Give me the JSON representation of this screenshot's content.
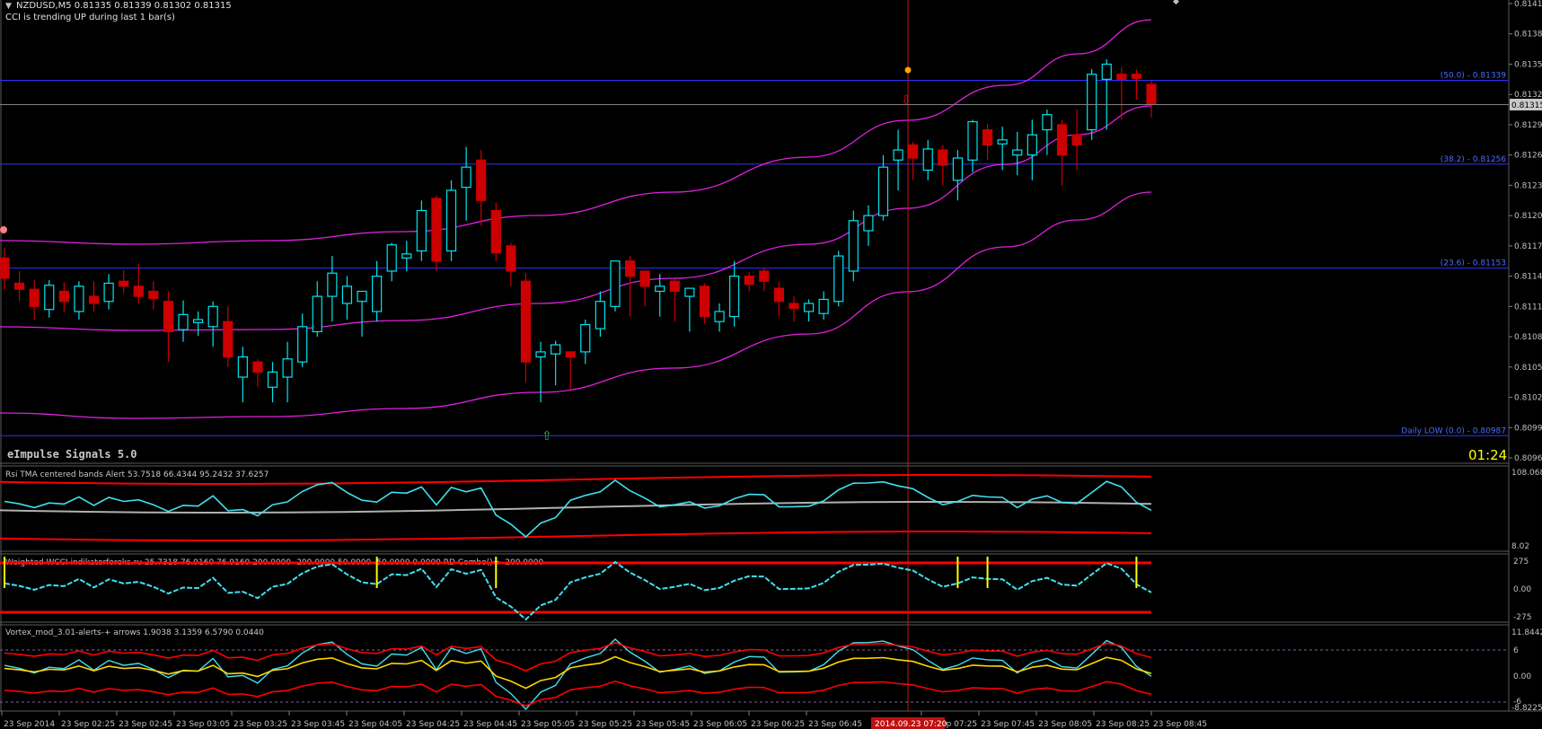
{
  "header": {
    "symbol_line": "NZDUSD,M5  0.81335 0.81339 0.81302 0.81315",
    "cci_note": "CCI is trending UP during last 1 bar(s)"
  },
  "main": {
    "indicator_name": "eImpulse Signals 5.0",
    "timer": "01:24",
    "price_ticks": [
      "0.81415",
      "0.81385",
      "0.81355",
      "0.81325",
      "0.81295",
      "0.81265",
      "0.81235",
      "0.81205",
      "0.81175",
      "0.81145",
      "0.81115",
      "0.81085",
      "0.81055",
      "0.81025",
      "0.80995",
      "0.80965"
    ],
    "current_price": "0.81315",
    "fib_levels": [
      {
        "label": "(50.0) -  0.81339",
        "price": 0.81339
      },
      {
        "label": "(38.2) -  0.81256",
        "price": 0.81256
      },
      {
        "label": "(23.6) -  0.81153",
        "price": 0.81153
      },
      {
        "label": "Daily LOW (0.0) -  0.80987",
        "price": 0.80987
      }
    ]
  },
  "sub1": {
    "title": "Rsi TMA centered bands Alert 53.7518 66.4344 95.2432 37.6257",
    "top_label": "108.068",
    "bottom_label": "8.02"
  },
  "sub2": {
    "title": "Weighted WCCI indikatorforeks.ru 25.7318 76.9160 76.9160 200.0000 -200.0000 50.0000 -50.0000 0.0000  RD Combo()=  -200.0000",
    "ticks": [
      "275",
      "0.00",
      "-275"
    ]
  },
  "sub3": {
    "title": "Vortex_mod_3.01-alerts-+ arrows 1.9038 3.1359 6.5790 0.0440",
    "ticks": [
      "11.8442",
      "6",
      "0.00",
      "-6",
      "-8.8225"
    ]
  },
  "time_axis": {
    "labels": [
      "23 Sep 2014",
      "23 Sep 02:25",
      "23 Sep 02:45",
      "23 Sep 03:05",
      "23 Sep 03:25",
      "23 Sep 03:45",
      "23 Sep 04:05",
      "23 Sep 04:25",
      "23 Sep 04:45",
      "23 Sep 05:05",
      "23 Sep 05:25",
      "23 Sep 05:45",
      "23 Sep 06:05",
      "23 Sep 06:25",
      "23 Sep 06:45",
      "23 Sep 07:25",
      "23 Sep 07:45",
      "23 Sep 08:05",
      "23 Sep 08:25",
      "23 Sep 08:45"
    ],
    "crosshair_label": "2014.09.23 07:20"
  },
  "colors": {
    "background": "#000000",
    "bull_candle": "#00e5ee",
    "bear_candle": "#cc0000",
    "envelope": "#e020e0",
    "fib_line": "#3030ff",
    "crosshair": "#d01010",
    "timer": "#ffff00",
    "rsi_line": "#40e0f0",
    "band": "#ff0000",
    "vortex_yellow": "#ffd700"
  },
  "chart_data": {
    "type": "candlestick",
    "symbol": "NZDUSD",
    "timeframe": "M5",
    "ylim": [
      0.80965,
      0.81415
    ],
    "x": [
      "02:05",
      "02:10",
      "02:15",
      "02:20",
      "02:25",
      "02:30",
      "02:35",
      "02:40",
      "02:45",
      "02:50",
      "02:55",
      "03:00",
      "03:05",
      "03:10",
      "03:15",
      "03:20",
      "03:25",
      "03:30",
      "03:35",
      "03:40",
      "03:45",
      "03:50",
      "03:55",
      "04:00",
      "04:05",
      "04:10",
      "04:15",
      "04:20",
      "04:25",
      "04:30",
      "04:35",
      "04:40",
      "04:45",
      "04:50",
      "04:55",
      "05:00",
      "05:05",
      "05:10",
      "05:15",
      "05:20",
      "05:25",
      "05:30",
      "05:35",
      "05:40",
      "05:45",
      "05:50",
      "05:55",
      "06:00",
      "06:05",
      "06:10",
      "06:15",
      "06:20",
      "06:25",
      "06:30",
      "06:35",
      "06:40",
      "06:45",
      "06:50",
      "06:55",
      "07:00",
      "07:05",
      "07:10",
      "07:15",
      "07:20",
      "07:25",
      "07:30",
      "07:35",
      "07:40",
      "07:45",
      "07:50",
      "07:55",
      "08:00",
      "08:05",
      "08:10",
      "08:15",
      "08:20",
      "08:25",
      "08:30",
      "08:35",
      "08:40"
    ],
    "ohlc": [
      [
        0.81163,
        0.81173,
        0.81132,
        0.81143
      ],
      [
        0.81138,
        0.8115,
        0.8112,
        0.81132
      ],
      [
        0.81132,
        0.81141,
        0.81102,
        0.81115
      ],
      [
        0.81112,
        0.81141,
        0.81104,
        0.81136
      ],
      [
        0.8113,
        0.81139,
        0.8111,
        0.8112
      ],
      [
        0.8111,
        0.8114,
        0.81102,
        0.81135
      ],
      [
        0.81125,
        0.8114,
        0.8111,
        0.81118
      ],
      [
        0.8112,
        0.81147,
        0.81112,
        0.81138
      ],
      [
        0.8114,
        0.81151,
        0.81128,
        0.81135
      ],
      [
        0.81135,
        0.81157,
        0.81118,
        0.81125
      ],
      [
        0.8113,
        0.8114,
        0.81112,
        0.81123
      ],
      [
        0.8112,
        0.8113,
        0.8106,
        0.8109
      ],
      [
        0.81092,
        0.81121,
        0.8108,
        0.81107
      ],
      [
        0.81099,
        0.8111,
        0.81086,
        0.81102
      ],
      [
        0.81095,
        0.8112,
        0.81075,
        0.81115
      ],
      [
        0.811,
        0.81115,
        0.81055,
        0.81065
      ],
      [
        0.81045,
        0.81075,
        0.8102,
        0.81065
      ],
      [
        0.8106,
        0.81063,
        0.81035,
        0.8105
      ],
      [
        0.81035,
        0.8106,
        0.8102,
        0.8105
      ],
      [
        0.81045,
        0.8108,
        0.8102,
        0.81063
      ],
      [
        0.8106,
        0.81108,
        0.81055,
        0.81095
      ],
      [
        0.8109,
        0.8114,
        0.81085,
        0.81125
      ],
      [
        0.81125,
        0.81165,
        0.811,
        0.81148
      ],
      [
        0.81118,
        0.81145,
        0.81102,
        0.81135
      ],
      [
        0.8112,
        0.81128,
        0.81085,
        0.8113
      ],
      [
        0.8111,
        0.8116,
        0.811,
        0.81145
      ],
      [
        0.8115,
        0.81178,
        0.8114,
        0.81176
      ],
      [
        0.81163,
        0.8118,
        0.8115,
        0.81167
      ],
      [
        0.8117,
        0.8122,
        0.8116,
        0.8121
      ],
      [
        0.81222,
        0.81225,
        0.8115,
        0.8116
      ],
      [
        0.8117,
        0.8124,
        0.8116,
        0.8123
      ],
      [
        0.81233,
        0.81273,
        0.812,
        0.81253
      ],
      [
        0.8126,
        0.8127,
        0.81195,
        0.8122
      ],
      [
        0.8121,
        0.81218,
        0.8116,
        0.81168
      ],
      [
        0.81175,
        0.81178,
        0.81135,
        0.8115
      ],
      [
        0.8114,
        0.81148,
        0.8104,
        0.8106
      ],
      [
        0.81065,
        0.8108,
        0.8102,
        0.8107
      ],
      [
        0.81068,
        0.81081,
        0.81037,
        0.81077
      ],
      [
        0.8107,
        0.8107,
        0.81032,
        0.81065
      ],
      [
        0.8107,
        0.81102,
        0.81058,
        0.81097
      ],
      [
        0.81093,
        0.8113,
        0.81085,
        0.8112
      ],
      [
        0.81115,
        0.81145,
        0.8111,
        0.8116
      ],
      [
        0.8116,
        0.81165,
        0.81105,
        0.81145
      ],
      [
        0.8115,
        0.81148,
        0.81115,
        0.81135
      ],
      [
        0.8113,
        0.81147,
        0.81105,
        0.81135
      ],
      [
        0.8114,
        0.81142,
        0.811,
        0.8113
      ],
      [
        0.81125,
        0.8113,
        0.8109,
        0.81133
      ],
      [
        0.81135,
        0.81138,
        0.81098,
        0.81105
      ],
      [
        0.811,
        0.81118,
        0.8109,
        0.8111
      ],
      [
        0.81105,
        0.8116,
        0.81095,
        0.81145
      ],
      [
        0.81145,
        0.81149,
        0.8113,
        0.81137
      ],
      [
        0.8115,
        0.81153,
        0.8113,
        0.8114
      ],
      [
        0.81133,
        0.8114,
        0.81105,
        0.8112
      ],
      [
        0.81118,
        0.81125,
        0.811,
        0.81113
      ],
      [
        0.8111,
        0.81122,
        0.811,
        0.81118
      ],
      [
        0.81108,
        0.8113,
        0.81102,
        0.81122
      ],
      [
        0.8112,
        0.8117,
        0.81115,
        0.81165
      ],
      [
        0.8115,
        0.8121,
        0.8114,
        0.812
      ],
      [
        0.8119,
        0.81215,
        0.81175,
        0.81205
      ],
      [
        0.81205,
        0.81265,
        0.812,
        0.81253
      ],
      [
        0.8126,
        0.8129,
        0.8123,
        0.8127
      ],
      [
        0.81275,
        0.81278,
        0.8124,
        0.81262
      ],
      [
        0.8125,
        0.8128,
        0.8124,
        0.81271
      ],
      [
        0.8127,
        0.81275,
        0.81235,
        0.81255
      ],
      [
        0.8124,
        0.8127,
        0.8122,
        0.81262
      ],
      [
        0.8126,
        0.813,
        0.81248,
        0.81298
      ],
      [
        0.8129,
        0.81296,
        0.8126,
        0.81275
      ],
      [
        0.81276,
        0.81293,
        0.8125,
        0.8128
      ],
      [
        0.81265,
        0.81288,
        0.81245,
        0.8127
      ],
      [
        0.81265,
        0.813,
        0.8124,
        0.81285
      ],
      [
        0.8129,
        0.8131,
        0.81265,
        0.81305
      ],
      [
        0.81295,
        0.813,
        0.81235,
        0.81265
      ],
      [
        0.81285,
        0.8131,
        0.8125,
        0.81275
      ],
      [
        0.8129,
        0.8135,
        0.8128,
        0.81345
      ],
      [
        0.8134,
        0.8136,
        0.8129,
        0.81355
      ],
      [
        0.81345,
        0.81352,
        0.813,
        0.8134
      ],
      [
        0.81345,
        0.8135,
        0.8132,
        0.81341
      ],
      [
        0.81335,
        0.81339,
        0.81302,
        0.81315
      ]
    ],
    "envelope_note": "TMA centered bands (magenta)",
    "subwindows": [
      {
        "name": "Rsi TMA centered bands Alert",
        "ylim": [
          8.02,
          108.068
        ]
      },
      {
        "name": "Weighted WCCI",
        "ylim": [
          -275,
          275
        ]
      },
      {
        "name": "Vortex_mod_3.01",
        "ylim": [
          -8.8225,
          11.8442
        ]
      }
    ]
  }
}
